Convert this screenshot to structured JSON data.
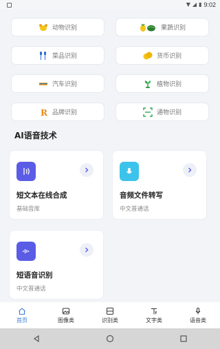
{
  "status_bar": {
    "time": "9:02"
  },
  "chips": [
    {
      "label": "动物识别",
      "icon": "animal-icon"
    },
    {
      "label": "果蔬识别",
      "icon": "fruit-icon"
    },
    {
      "label": "菜品识别",
      "icon": "dish-icon"
    },
    {
      "label": "货币识别",
      "icon": "currency-icon"
    },
    {
      "label": "汽车识别",
      "icon": "car-icon"
    },
    {
      "label": "植物识别",
      "icon": "plant-icon"
    },
    {
      "label": "品牌识别",
      "icon": "brand-icon"
    },
    {
      "label": "通物识别",
      "icon": "object-scan-icon"
    }
  ],
  "section": {
    "title": "AI语音技术"
  },
  "cards": [
    {
      "title": "短文本在线合成",
      "subtitle": "基础音库",
      "icon": "speech-synthesis-icon",
      "color": "#5b5ce6"
    },
    {
      "title": "音频文件转写",
      "subtitle": "中文普通话",
      "icon": "microphone-icon",
      "color": "#3cc3ec"
    },
    {
      "title": "短语音识别",
      "subtitle": "中文普通话",
      "icon": "voice-wave-icon",
      "color": "#5b5ce6"
    }
  ],
  "tabs": [
    {
      "label": "首页",
      "icon": "home-icon",
      "active": true
    },
    {
      "label": "图像类",
      "icon": "image-icon",
      "active": false
    },
    {
      "label": "识别类",
      "icon": "scan-icon",
      "active": false
    },
    {
      "label": "文字类",
      "icon": "text-icon",
      "active": false
    },
    {
      "label": "语音类",
      "icon": "voice-icon",
      "active": false
    }
  ],
  "colors": {
    "accent": "#3a7bd5",
    "background": "#f2f4f8"
  }
}
